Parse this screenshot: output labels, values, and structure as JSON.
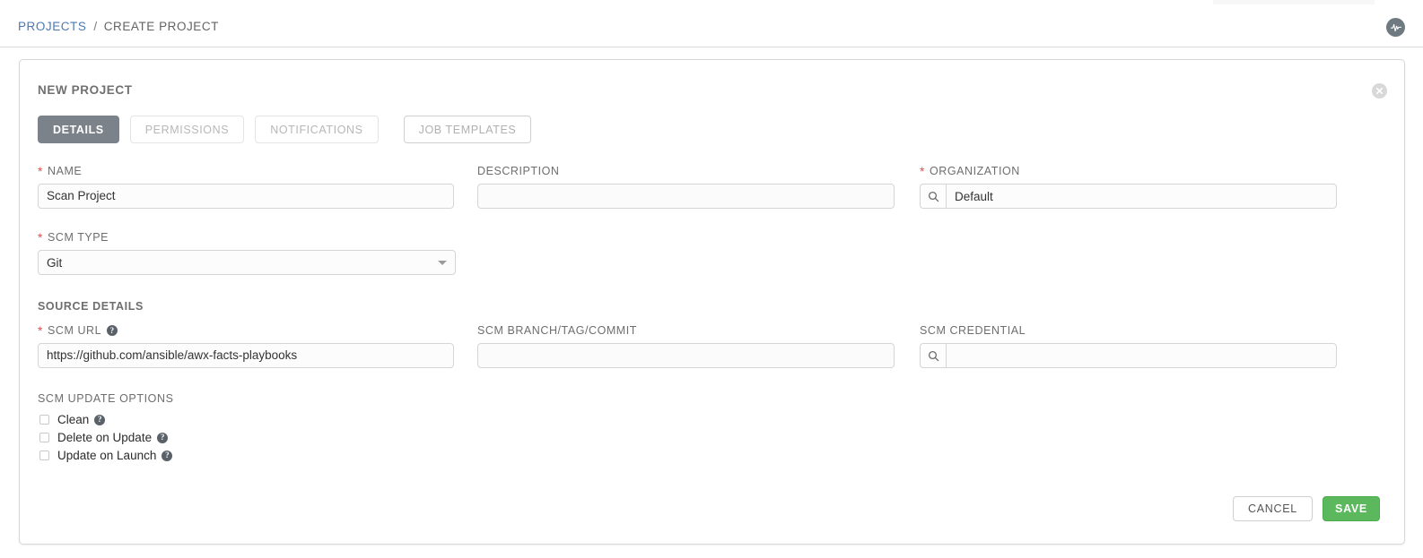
{
  "breadcrumb": {
    "root": "PROJECTS",
    "separator": "/",
    "current": "CREATE PROJECT"
  },
  "header": {
    "logo_icon": "pulse-waveform-icon"
  },
  "card": {
    "title": "NEW PROJECT",
    "close_icon": "close-circle-icon"
  },
  "tabs": [
    {
      "label": "DETAILS",
      "active": true
    },
    {
      "label": "PERMISSIONS",
      "active": false
    },
    {
      "label": "NOTIFICATIONS",
      "active": false
    },
    {
      "label": "JOB TEMPLATES",
      "active": false
    }
  ],
  "fields": {
    "name": {
      "label": "NAME",
      "required": true,
      "value": "Scan Project",
      "placeholder": ""
    },
    "description": {
      "label": "DESCRIPTION",
      "required": false,
      "value": "",
      "placeholder": ""
    },
    "organization": {
      "label": "ORGANIZATION",
      "required": true,
      "value": "Default",
      "placeholder": "",
      "lookup_icon": "search-icon"
    },
    "scm_type": {
      "label": "SCM TYPE",
      "required": true,
      "value": "Git",
      "caret_icon": "chevron-down-icon"
    },
    "scm_url": {
      "label": "SCM URL",
      "required": true,
      "value": "https://github.com/ansible/awx-facts-playbooks",
      "help_icon": "question-circle-icon"
    },
    "scm_branch": {
      "label": "SCM BRANCH/TAG/COMMIT",
      "required": false,
      "value": "",
      "placeholder": ""
    },
    "scm_credential": {
      "label": "SCM CREDENTIAL",
      "required": false,
      "value": "",
      "placeholder": "",
      "lookup_icon": "search-icon"
    }
  },
  "sections": {
    "source_details": "SOURCE DETAILS",
    "scm_update_options": "SCM UPDATE OPTIONS"
  },
  "checkboxes": [
    {
      "label": "Clean",
      "checked": false,
      "help_icon": "question-circle-icon"
    },
    {
      "label": "Delete on Update",
      "checked": false,
      "help_icon": "question-circle-icon"
    },
    {
      "label": "Update on Launch",
      "checked": false,
      "help_icon": "question-circle-icon"
    }
  ],
  "footer": {
    "cancel_label": "CANCEL",
    "save_label": "SAVE"
  },
  "colors": {
    "link": "#4a7ab5",
    "required_asterisk": "#d9534f",
    "save_green": "#5cb85c",
    "tab_active_bg": "#7b8289"
  }
}
